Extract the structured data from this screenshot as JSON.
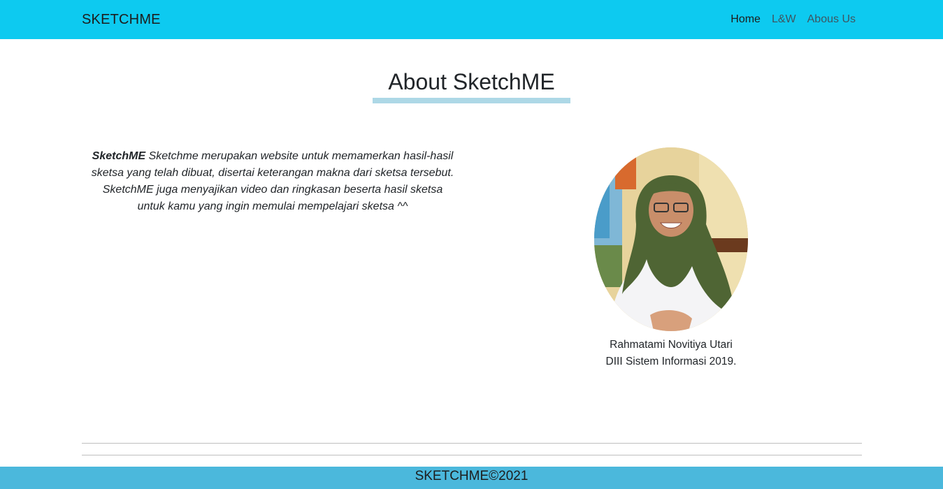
{
  "navbar": {
    "brand": "SKETCHME",
    "links": [
      {
        "label": "Home",
        "active": true
      },
      {
        "label": "L&W",
        "active": false
      },
      {
        "label": "Abous Us",
        "active": false
      }
    ]
  },
  "main": {
    "title": "About SketchME",
    "description": {
      "lead": "SketchME",
      "body": " Sketchme merupakan website untuk memamerkan hasil-hasil sketsa yang telah dibuat, disertai keterangan makna dari sketsa tersebut. SketchME juga menyajikan video dan ringkasan beserta hasil sketsa untuk kamu yang ingin memulai mempelajari sketsa ^^"
    },
    "profile": {
      "name": "Rahmatami Novitiya Utari",
      "program": "DIII Sistem Informasi 2019."
    }
  },
  "footer": {
    "text": "SKETCHME©2021"
  },
  "colors": {
    "navbar": "#0dcaf0",
    "title_underline": "#add8e6",
    "footer": "#4bb8dc"
  }
}
